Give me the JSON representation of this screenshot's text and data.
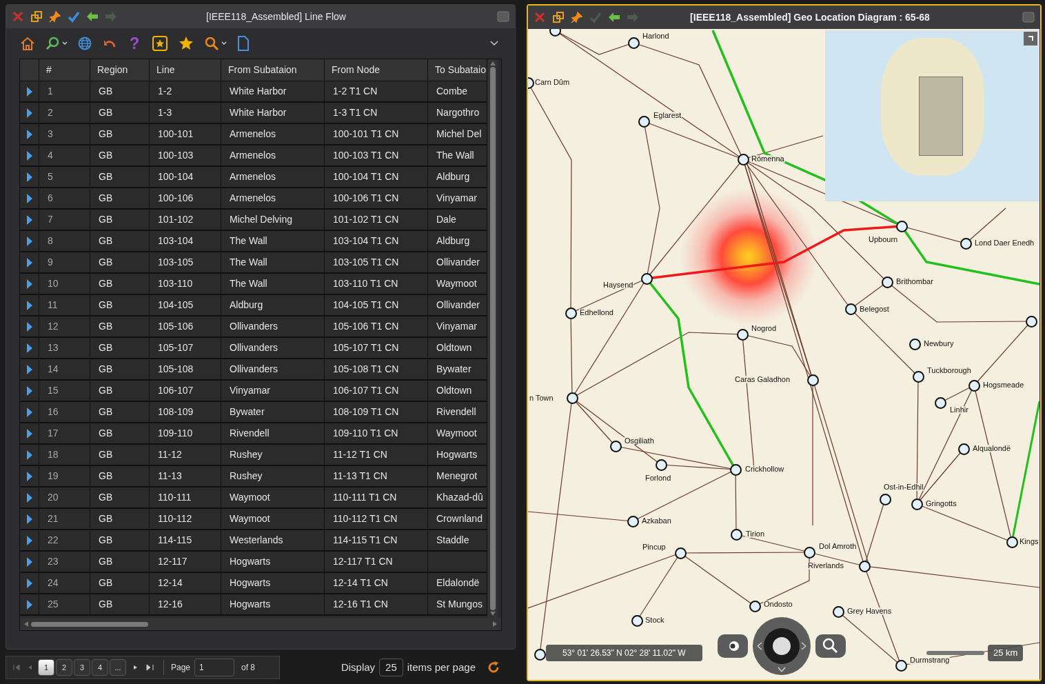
{
  "line_flow": {
    "title": "[IEEE118_Assembled] Line Flow",
    "titlebar_icons": [
      {
        "kind": "close",
        "disabled": false
      },
      {
        "kind": "restore",
        "disabled": false
      },
      {
        "kind": "pin",
        "disabled": false
      },
      {
        "kind": "check",
        "disabled": false
      },
      {
        "kind": "back",
        "disabled": false
      },
      {
        "kind": "forward",
        "disabled": true
      }
    ],
    "toolbar": {
      "help_glyph": "?"
    },
    "table": {
      "columns": [
        "#",
        "Region",
        "Line",
        "From Subataion",
        "From Node",
        "To Subataio"
      ],
      "rows": [
        {
          "num": "1",
          "region": "GB",
          "line": "1-2",
          "from_sub": "White Harbor",
          "from_node": "1-2 T1 CN",
          "to_sub": "Combe"
        },
        {
          "num": "2",
          "region": "GB",
          "line": "1-3",
          "from_sub": "White Harbor",
          "from_node": "1-3 T1 CN",
          "to_sub": "Nargothro"
        },
        {
          "num": "3",
          "region": "GB",
          "line": "100-101",
          "from_sub": "Armenelos",
          "from_node": "100-101 T1 CN",
          "to_sub": "Michel Del"
        },
        {
          "num": "4",
          "region": "GB",
          "line": "100-103",
          "from_sub": "Armenelos",
          "from_node": "100-103 T1 CN",
          "to_sub": "The Wall"
        },
        {
          "num": "5",
          "region": "GB",
          "line": "100-104",
          "from_sub": "Armenelos",
          "from_node": "100-104 T1 CN",
          "to_sub": "Aldburg"
        },
        {
          "num": "6",
          "region": "GB",
          "line": "100-106",
          "from_sub": "Armenelos",
          "from_node": "100-106 T1 CN",
          "to_sub": "Vinyamar"
        },
        {
          "num": "7",
          "region": "GB",
          "line": "101-102",
          "from_sub": "Michel Delving",
          "from_node": "101-102 T1 CN",
          "to_sub": "Dale"
        },
        {
          "num": "8",
          "region": "GB",
          "line": "103-104",
          "from_sub": "The Wall",
          "from_node": "103-104 T1 CN",
          "to_sub": "Aldburg"
        },
        {
          "num": "9",
          "region": "GB",
          "line": "103-105",
          "from_sub": "The Wall",
          "from_node": "103-105 T1 CN",
          "to_sub": "Ollivander"
        },
        {
          "num": "10",
          "region": "GB",
          "line": "103-110",
          "from_sub": "The Wall",
          "from_node": "103-110 T1 CN",
          "to_sub": "Waymoot"
        },
        {
          "num": "11",
          "region": "GB",
          "line": "104-105",
          "from_sub": "Aldburg",
          "from_node": "104-105 T1 CN",
          "to_sub": "Ollivander"
        },
        {
          "num": "12",
          "region": "GB",
          "line": "105-106",
          "from_sub": "Ollivanders",
          "from_node": "105-106 T1 CN",
          "to_sub": "Vinyamar"
        },
        {
          "num": "13",
          "region": "GB",
          "line": "105-107",
          "from_sub": "Ollivanders",
          "from_node": "105-107 T1 CN",
          "to_sub": "Oldtown"
        },
        {
          "num": "14",
          "region": "GB",
          "line": "105-108",
          "from_sub": "Ollivanders",
          "from_node": "105-108 T1 CN",
          "to_sub": "Bywater"
        },
        {
          "num": "15",
          "region": "GB",
          "line": "106-107",
          "from_sub": "Vinyamar",
          "from_node": "106-107 T1 CN",
          "to_sub": "Oldtown"
        },
        {
          "num": "16",
          "region": "GB",
          "line": "108-109",
          "from_sub": "Bywater",
          "from_node": "108-109 T1 CN",
          "to_sub": "Rivendell"
        },
        {
          "num": "17",
          "region": "GB",
          "line": "109-110",
          "from_sub": "Rivendell",
          "from_node": "109-110 T1 CN",
          "to_sub": "Waymoot"
        },
        {
          "num": "18",
          "region": "GB",
          "line": "11-12",
          "from_sub": "Rushey",
          "from_node": "11-12 T1 CN",
          "to_sub": "Hogwarts"
        },
        {
          "num": "19",
          "region": "GB",
          "line": "11-13",
          "from_sub": "Rushey",
          "from_node": "11-13 T1 CN",
          "to_sub": "Menegrot"
        },
        {
          "num": "20",
          "region": "GB",
          "line": "110-111",
          "from_sub": "Waymoot",
          "from_node": "110-111 T1 CN",
          "to_sub": "Khazad-dû"
        },
        {
          "num": "21",
          "region": "GB",
          "line": "110-112",
          "from_sub": "Waymoot",
          "from_node": "110-112 T1 CN",
          "to_sub": "Crownland"
        },
        {
          "num": "22",
          "region": "GB",
          "line": "114-115",
          "from_sub": "Westerlands",
          "from_node": "114-115 T1 CN",
          "to_sub": "Staddle"
        },
        {
          "num": "23",
          "region": "GB",
          "line": "12-117",
          "from_sub": "Hogwarts",
          "from_node": "12-117 T1 CN"
        },
        {
          "num": "24",
          "region": "GB",
          "line": "12-14",
          "from_sub": "Hogwarts",
          "from_node": "12-14 T1 CN",
          "to_sub": "Eldalondë"
        },
        {
          "num": "25",
          "region": "GB",
          "line": "12-16",
          "from_sub": "Hogwarts",
          "from_node": "12-16 T1 CN",
          "to_sub": "St Mungos"
        }
      ]
    },
    "pager": {
      "pages": [
        {
          "label": "1",
          "selected": true
        },
        {
          "label": "2",
          "selected": false
        },
        {
          "label": "3",
          "selected": false
        },
        {
          "label": "4",
          "selected": false
        }
      ],
      "more": "...",
      "page_label": "Page",
      "page_value": "1",
      "of": "of 8",
      "display": "Display",
      "per_page": "25",
      "items_label": "items per page"
    }
  },
  "geo": {
    "title": "[IEEE118_Assembled] Geo Location Diagram : 65-68",
    "active": true,
    "titlebar_icons": [
      {
        "kind": "close",
        "disabled": false
      },
      {
        "kind": "restore",
        "disabled": false
      },
      {
        "kind": "pin",
        "disabled": false
      },
      {
        "kind": "check",
        "disabled": true
      },
      {
        "kind": "back",
        "disabled": false
      },
      {
        "kind": "forward",
        "disabled": true
      }
    ],
    "nodes": [
      {
        "label": "Harlond",
        "marker": true
      },
      {
        "label": "Carn Dûm",
        "marker": true
      },
      {
        "label": "Eglarest",
        "marker": true
      },
      {
        "label": "Rómenna",
        "marker": true
      },
      {
        "label": "Upbourn",
        "marker": true
      },
      {
        "label": "Lond Daer Enedh",
        "marker": true
      },
      {
        "label": "Haysend",
        "marker": true
      },
      {
        "label": "Brithombar",
        "marker": true
      },
      {
        "label": "Edhellond",
        "marker": true
      },
      {
        "label": "Belegost",
        "marker": true
      },
      {
        "label": "Nogrod",
        "marker": true
      },
      {
        "label": "Newbury",
        "marker": true
      },
      {
        "label": "Caras Galadhon",
        "marker": false
      },
      {
        "label": "Tuckborough",
        "marker": true
      },
      {
        "label": "Hogsmeade",
        "marker": true
      },
      {
        "label": "Linhir",
        "marker": true
      },
      {
        "label": "n Town",
        "marker": true
      },
      {
        "label": "Osgiliath",
        "marker": true
      },
      {
        "label": "Forlond",
        "marker": true
      },
      {
        "label": "Crickhollow",
        "marker": true
      },
      {
        "label": "Alqualondë",
        "marker": true
      },
      {
        "label": "Ost-in-Edhil",
        "marker": true
      },
      {
        "label": "Gringotts",
        "marker": true
      },
      {
        "label": "Azkaban",
        "marker": true
      },
      {
        "label": "Tirion",
        "marker": true
      },
      {
        "label": "Pincup",
        "marker": true
      },
      {
        "label": "Dol Amroth",
        "marker": true
      },
      {
        "label": "Riverlands",
        "marker": true
      },
      {
        "label": "Kings",
        "marker": true
      },
      {
        "label": "Ondosto",
        "marker": true
      },
      {
        "label": "Grey Havens",
        "marker": true
      },
      {
        "label": "Stock",
        "marker": true
      },
      {
        "label": "Durmstrang",
        "marker": true
      }
    ],
    "coordinates": "53° 01' 26.53\" N 02° 28' 11.02\" W",
    "scale": "25 km"
  }
}
